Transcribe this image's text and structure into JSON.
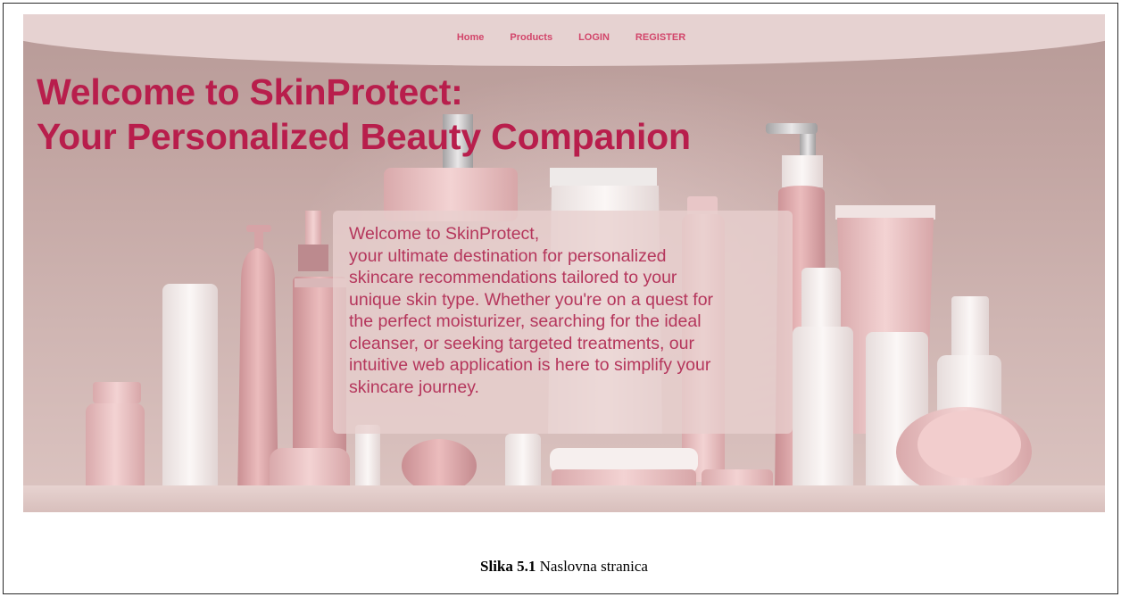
{
  "nav": {
    "home": "Home",
    "products": "Products",
    "login": "LOGIN",
    "register": "REGISTER"
  },
  "hero": {
    "title_line1": "Welcome to SkinProtect:",
    "title_line2": "Your Personalized Beauty Companion"
  },
  "intro": {
    "lines": [
      "Welcome to SkinProtect,",
      "your ultimate destination for personalized",
      "skincare recommendations tailored to your",
      "unique skin type. Whether you're on a quest for",
      "the perfect moisturizer, searching for the ideal",
      "cleanser, or seeking targeted treatments, our",
      "intuitive web application is here to simplify your",
      "skincare journey."
    ]
  },
  "caption": {
    "label": "Slika 5.1",
    "text": "Naslovna stranica"
  },
  "colors": {
    "nav_link": "#d2456a",
    "hero_title": "#b81e4c",
    "intro_text": "#b5365c",
    "nav_bar": "#e6d2d1",
    "background": "#c3a6a3"
  },
  "icons": {
    "products_illustration": "skincare-bottles-image"
  }
}
